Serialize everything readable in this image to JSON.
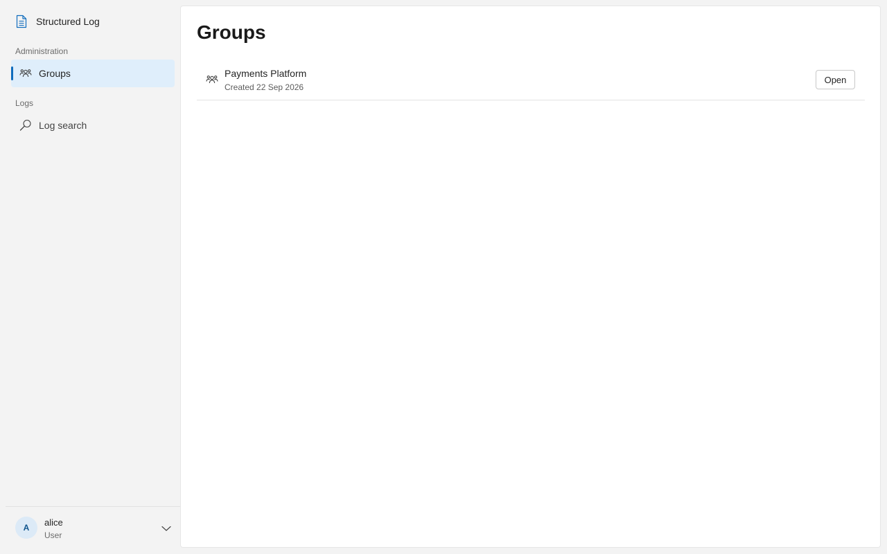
{
  "app": {
    "title": "Structured Log"
  },
  "sidebar": {
    "sections": [
      {
        "label": "Administration",
        "items": [
          {
            "label": "Groups",
            "icon": "people-icon",
            "active": true
          }
        ]
      },
      {
        "label": "Logs",
        "items": [
          {
            "label": "Log search",
            "icon": "search-icon",
            "active": false
          }
        ]
      }
    ],
    "user": {
      "initial": "A",
      "name": "alice",
      "role": "User"
    }
  },
  "main": {
    "title": "Groups",
    "groups": [
      {
        "name": "Payments Platform",
        "created": "Created 22 Sep 2026",
        "action_label": "Open"
      }
    ]
  },
  "colors": {
    "accent": "#0f6cbd",
    "active_item_bg": "#dfeefb",
    "sidebar_bg": "#f3f3f3",
    "content_bg": "#ffffff"
  }
}
